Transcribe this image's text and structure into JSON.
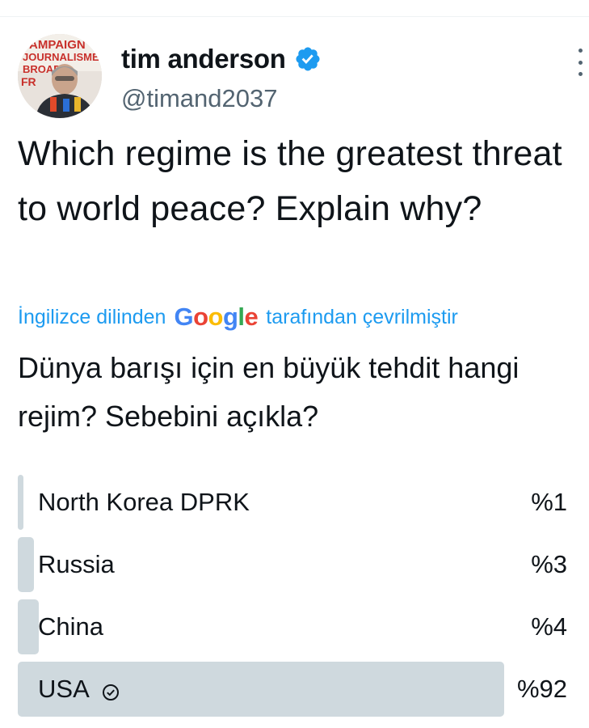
{
  "tweet": {
    "author_name": "tim anderson",
    "author_handle": "@timand2037",
    "verified_icon": "verified-badge-icon",
    "more_icon": "more-options-icon",
    "text": "Which regime is the greatest threat to world peace? Explain why?",
    "translation_prefix": "İngilizce dilinden",
    "translation_provider": "Google",
    "translation_suffix": "tarafından çevrilmiştir",
    "translated_text": "Dünya barışı için en büyük tehdit hangi rejim? Sebebini açıkla?",
    "avatar_sign_text": "CAMPAIGN JOURNALISME BROAD FR"
  },
  "poll": {
    "options": [
      {
        "label": "North Korea DPRK",
        "percent_label": "%1",
        "percent": 1,
        "winner": false
      },
      {
        "label": "Russia",
        "percent_label": "%3",
        "percent": 3,
        "winner": false
      },
      {
        "label": "China",
        "percent_label": "%4",
        "percent": 4,
        "winner": false
      },
      {
        "label": "USA",
        "percent_label": "%92",
        "percent": 92,
        "winner": true
      }
    ],
    "check_icon": "check-circle-icon"
  },
  "colors": {
    "text": "#0f1419",
    "secondary": "#536471",
    "link": "#1d9bf0",
    "verified": "#1d9bf0",
    "bar": "#cfd9de"
  }
}
